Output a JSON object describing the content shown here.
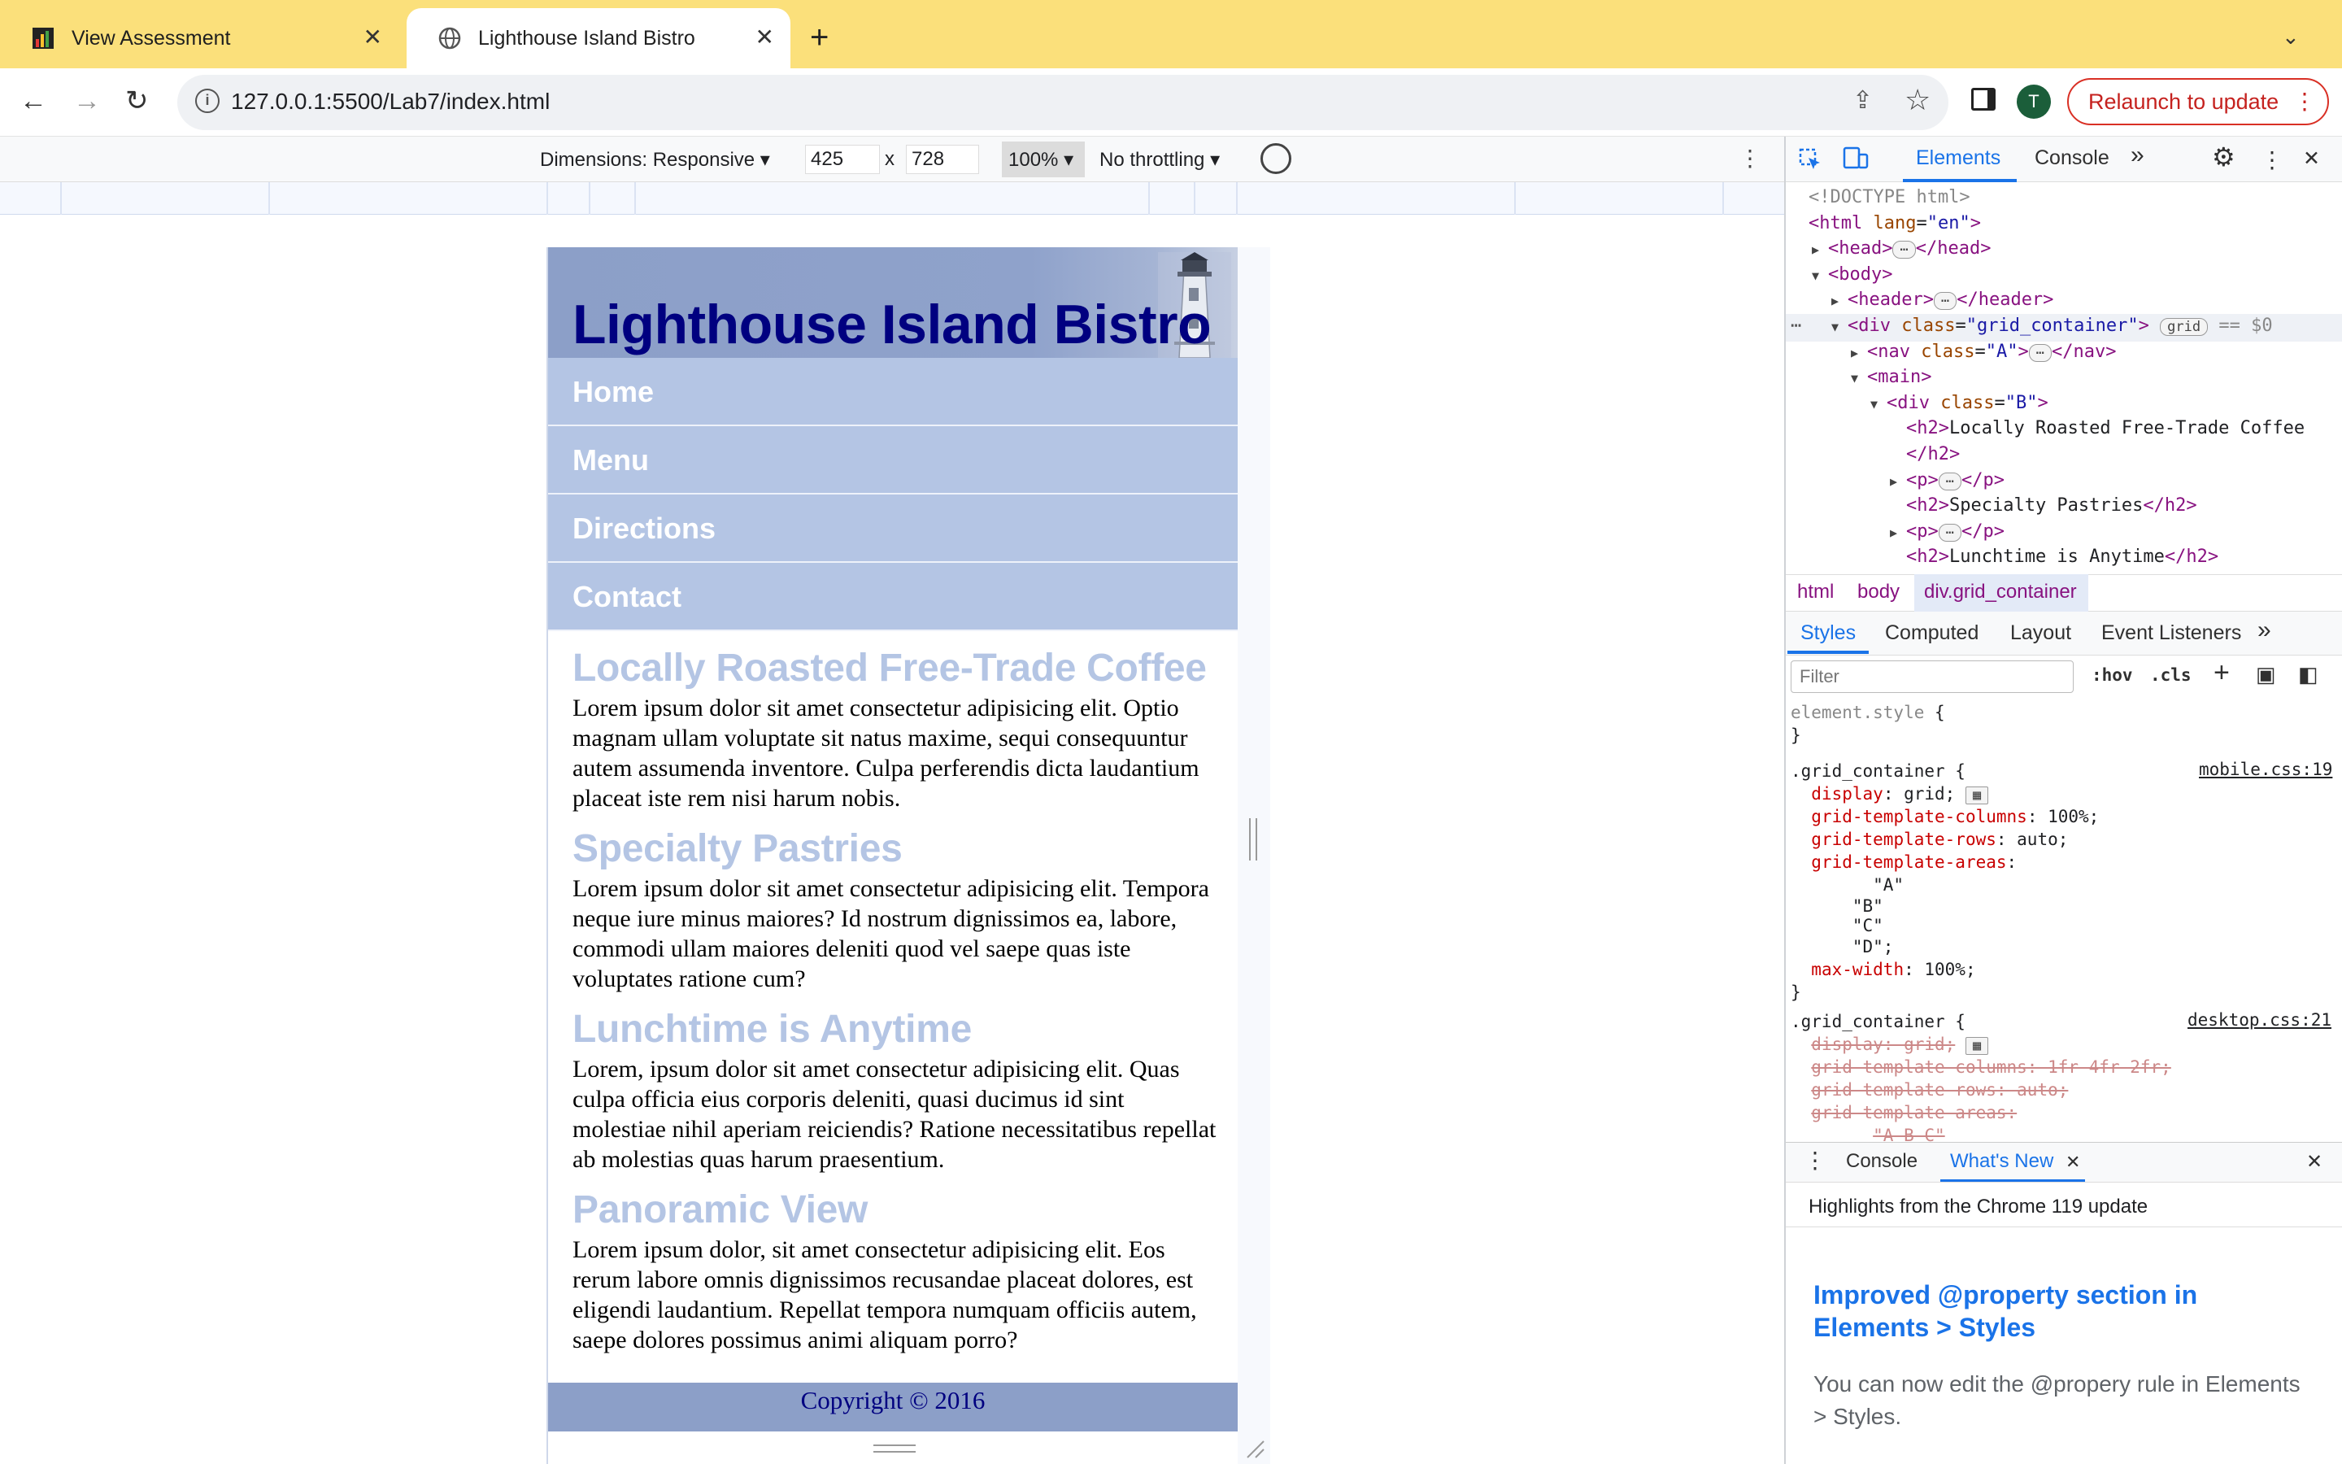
{
  "browser": {
    "tabs": [
      {
        "title": "View Assessment",
        "icon": "bar-chart-favicon",
        "active": false
      },
      {
        "title": "Lighthouse Island Bistro",
        "icon": "globe-favicon",
        "active": true
      }
    ],
    "close_glyph": "✕",
    "new_tab_glyph": "+",
    "tab_menu_glyph": "⌄",
    "address": "127.0.0.1:5500/Lab7/index.html",
    "avatar_initial": "T",
    "relaunch_label": "Relaunch to update",
    "nav_glyphs": {
      "back": "←",
      "forward": "→",
      "reload": "↻",
      "share": "⇪",
      "star": "☆",
      "more": "⋮"
    }
  },
  "device_toolbar": {
    "dimensions_label": "Dimensions: Responsive",
    "width": "425",
    "times": "x",
    "height": "728",
    "zoom": "100%",
    "throttling": "No throttling",
    "caret": "▾"
  },
  "site": {
    "title": "Lighthouse Island Bistro",
    "nav": [
      "Home",
      "Menu",
      "Directions",
      "Contact"
    ],
    "sections": [
      {
        "heading": "Locally Roasted Free-Trade Coffee",
        "body": "Lorem ipsum dolor sit amet consectetur adipisicing elit. Optio magnam ullam voluptate sit natus maxime, sequi consequuntur autem assumenda inventore. Culpa perferendis dicta laudantium placeat iste rem nisi harum nobis."
      },
      {
        "heading": "Specialty Pastries",
        "body": "Lorem ipsum dolor sit amet consectetur adipisicing elit. Tempora neque iure minus maiores? Id nostrum dignissimos ea, labore, commodi ullam maiores deleniti quod vel saepe quas iste voluptates ratione cum?"
      },
      {
        "heading": "Lunchtime is Anytime",
        "body": "Lorem, ipsum dolor sit amet consectetur adipisicing elit. Quas culpa officia eius corporis deleniti, quasi ducimus id sint molestiae nihil aperiam reiciendis? Ratione necessitatibus repellat ab molestias quas harum praesentium."
      },
      {
        "heading": "Panoramic View",
        "body": "Lorem ipsum dolor, sit amet consectetur adipisicing elit. Eos rerum labore omnis dignissimos recusandae placeat dolores, est eligendi laudantium. Repellat tempora numquam officiis autem, saepe dolores possimus animi aliquam porro?"
      }
    ],
    "footer": "Copyright © 2016"
  },
  "devtools": {
    "tabs": [
      "Elements",
      "Console"
    ],
    "more_tabs": "»",
    "dom_lines": [
      {
        "indent": 0,
        "arrow": "",
        "html": "<span class='gray'>&lt;!DOCTYPE html&gt;</span>"
      },
      {
        "indent": 0,
        "arrow": "",
        "html": "<span class='tag'>&lt;html</span> <span class='attr'>lang</span>=<span class='val'>\"en\"</span><span class='tag'>&gt;</span>"
      },
      {
        "indent": 1,
        "arrow": "▶",
        "html": "<span class='tag'>&lt;head&gt;</span><span class='badge'>⋯</span><span class='tag'>&lt;/head&gt;</span>"
      },
      {
        "indent": 1,
        "arrow": "▼",
        "html": "<span class='tag'>&lt;body&gt;</span>"
      },
      {
        "indent": 2,
        "arrow": "▶",
        "html": "<span class='tag'>&lt;header&gt;</span><span class='badge'>⋯</span><span class='tag'>&lt;/header&gt;</span>"
      },
      {
        "indent": 2,
        "arrow": "▼",
        "html": "<span class='tag'>&lt;div</span> <span class='attr'>class</span>=<span class='val'>\"grid_container\"</span><span class='tag'>&gt;</span> <span class='badge'>grid</span> <span class='gray'>== $0</span>"
      },
      {
        "indent": 3,
        "arrow": "▶",
        "html": "<span class='tag'>&lt;nav</span> <span class='attr'>class</span>=<span class='val'>\"A\"</span><span class='tag'>&gt;</span><span class='badge'>⋯</span><span class='tag'>&lt;/nav&gt;</span>"
      },
      {
        "indent": 3,
        "arrow": "▼",
        "html": "<span class='tag'>&lt;main&gt;</span>"
      },
      {
        "indent": 4,
        "arrow": "▼",
        "html": "<span class='tag'>&lt;div</span> <span class='attr'>class</span>=<span class='val'>\"B\"</span><span class='tag'>&gt;</span>"
      },
      {
        "indent": 5,
        "arrow": "",
        "html": "<span class='tag'>&lt;h2&gt;</span>Locally Roasted Free-Trade Coffee"
      },
      {
        "indent": 5,
        "arrow": "",
        "html": "<span class='tag'>&lt;/h2&gt;</span>"
      },
      {
        "indent": 5,
        "arrow": "▶",
        "html": "<span class='tag'>&lt;p&gt;</span><span class='badge'>⋯</span><span class='tag'>&lt;/p&gt;</span>"
      },
      {
        "indent": 5,
        "arrow": "",
        "html": "<span class='tag'>&lt;h2&gt;</span>Specialty Pastries<span class='tag'>&lt;/h2&gt;</span>"
      },
      {
        "indent": 5,
        "arrow": "▶",
        "html": "<span class='tag'>&lt;p&gt;</span><span class='badge'>⋯</span><span class='tag'>&lt;/p&gt;</span>"
      },
      {
        "indent": 5,
        "arrow": "",
        "html": "<span class='tag'>&lt;h2&gt;</span>Lunchtime is Anytime<span class='tag'>&lt;/h2&gt;</span>"
      }
    ],
    "breadcrumbs": [
      "html",
      "body",
      "div.grid_container"
    ],
    "subtabs": [
      "Styles",
      "Computed",
      "Layout",
      "Event Listeners"
    ],
    "filter_placeholder": "Filter",
    "hov": ":hov",
    "cls": ".cls",
    "css_lines": [
      {
        "html": "<span class='gray'>element.style</span> {"
      },
      {
        "html": "}"
      },
      {
        "html": ".grid_container {"
      },
      {
        "html": "&nbsp;&nbsp;<span class='prop'>display</span>: grid; <span class='badge' style='border-radius:2px'>▦</span>"
      },
      {
        "html": "&nbsp;&nbsp;<span class='prop'>grid-template-columns</span>: 100%;"
      },
      {
        "html": "&nbsp;&nbsp;<span class='prop'>grid-template-rows</span>: auto;"
      },
      {
        "html": "&nbsp;&nbsp;<span class='prop'>grid-template-areas</span>:"
      },
      {
        "html": "&nbsp;&nbsp;&nbsp;&nbsp;&nbsp;&nbsp;&nbsp;&nbsp;\"A\""
      },
      {
        "html": "&nbsp;&nbsp;&nbsp;&nbsp;&nbsp;&nbsp;\"B\""
      },
      {
        "html": "&nbsp;&nbsp;&nbsp;&nbsp;&nbsp;&nbsp;\"C\""
      },
      {
        "html": "&nbsp;&nbsp;&nbsp;&nbsp;&nbsp;&nbsp;\"D\";"
      },
      {
        "html": "&nbsp;&nbsp;<span class='prop'>max-width</span>: 100%;"
      },
      {
        "html": "}"
      },
      {
        "html": ".grid_container {"
      },
      {
        "html": "&nbsp;&nbsp;<span class='strike'>display: grid;</span> <span class='badge' style='border-radius:2px'>▦</span>"
      },
      {
        "html": "&nbsp;&nbsp;<span class='strike'>grid-template-columns: 1fr 4fr 2fr;</span>"
      },
      {
        "html": "&nbsp;&nbsp;<span class='strike'>grid-template-rows: auto;</span>"
      },
      {
        "html": "&nbsp;&nbsp;<span class='strike'>grid-template-areas:</span>"
      },
      {
        "html": "&nbsp;&nbsp;&nbsp;&nbsp;&nbsp;&nbsp;&nbsp;&nbsp;<span class='strike'>\"A B C\"</span>"
      }
    ],
    "sources": [
      "mobile.css:19",
      "desktop.css:21"
    ],
    "drawer_tabs": [
      "Console",
      "What's New"
    ],
    "highlights": "Highlights from the Chrome 119 update",
    "whats_new_title": "Improved @property section in Elements > Styles",
    "whats_new_body": "You can now edit the @propery rule in Elements > Styles."
  }
}
